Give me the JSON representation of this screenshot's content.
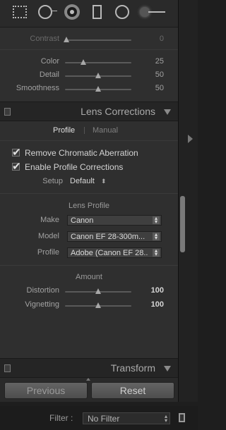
{
  "toolbar": {
    "tools": [
      "crop-overlay",
      "spot-removal",
      "red-eye-correction",
      "graduated-filter",
      "radial-filter",
      "adjustment-brush"
    ]
  },
  "basic": {
    "contrast": {
      "label": "Contrast",
      "value": "0",
      "position": 0.02
    },
    "color": {
      "label": "Color",
      "value": "25",
      "position": 0.28
    },
    "detail": {
      "label": "Detail",
      "value": "50",
      "position": 0.5
    },
    "smoothness": {
      "label": "Smoothness",
      "value": "50",
      "position": 0.5
    }
  },
  "lens_corrections": {
    "title": "Lens Corrections",
    "tabs": {
      "profile": "Profile",
      "manual": "Manual"
    },
    "remove_ca": {
      "label": "Remove Chromatic Aberration",
      "checked": true
    },
    "enable_profile": {
      "label": "Enable Profile Corrections",
      "checked": true
    },
    "setup": {
      "label": "Setup",
      "value": "Default"
    },
    "lens_profile": {
      "title": "Lens Profile",
      "make": {
        "label": "Make",
        "value": "Canon"
      },
      "model": {
        "label": "Model",
        "value": "Canon EF 28-300m..."
      },
      "profile": {
        "label": "Profile",
        "value": "Adobe (Canon EF 28..."
      }
    },
    "amount": {
      "title": "Amount",
      "distortion": {
        "label": "Distortion",
        "value": "100",
        "position": 0.5
      },
      "vignetting": {
        "label": "Vignetting",
        "value": "100",
        "position": 0.5
      }
    }
  },
  "transform": {
    "title": "Transform"
  },
  "buttons": {
    "previous": "Previous",
    "reset": "Reset"
  },
  "filter": {
    "label": "Filter :",
    "value": "No Filter"
  }
}
